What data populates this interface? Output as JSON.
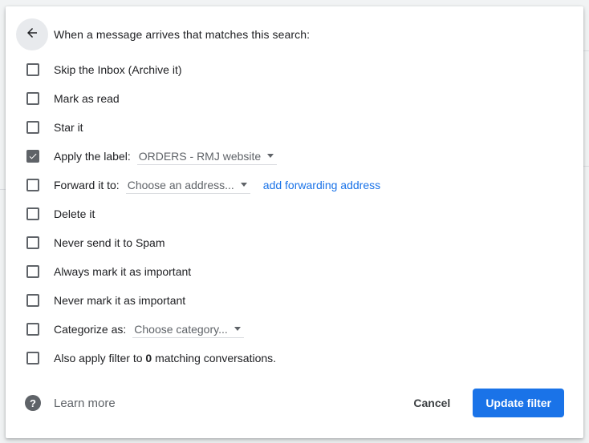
{
  "header": {
    "back_icon": "arrow-left-icon",
    "title": "When a message arrives that matches this search:"
  },
  "options": [
    {
      "label": "Skip the Inbox (Archive it)",
      "checked": false
    },
    {
      "label": "Mark as read",
      "checked": false
    },
    {
      "label": "Star it",
      "checked": false
    },
    {
      "label": "Apply the label:",
      "checked": true,
      "select_value": "ORDERS - RMJ website"
    },
    {
      "label": "Forward it to:",
      "checked": false,
      "select_value": "Choose an address...",
      "link": "add forwarding address"
    },
    {
      "label": "Delete it",
      "checked": false
    },
    {
      "label": "Never send it to Spam",
      "checked": false
    },
    {
      "label": "Always mark it as important",
      "checked": false
    },
    {
      "label": "Never mark it as important",
      "checked": false
    },
    {
      "label": "Categorize as:",
      "checked": false,
      "select_value": "Choose category..."
    },
    {
      "label_prefix": "Also apply filter to ",
      "label_count": "0",
      "label_suffix": " matching conversations.",
      "checked": false
    }
  ],
  "footer": {
    "help_icon": "help-circle-icon",
    "learn_more": "Learn more",
    "cancel_label": "Cancel",
    "update_label": "Update filter"
  },
  "colors": {
    "accent": "#1a73e8",
    "checkbox": "#5f6368",
    "text": "#202124"
  }
}
